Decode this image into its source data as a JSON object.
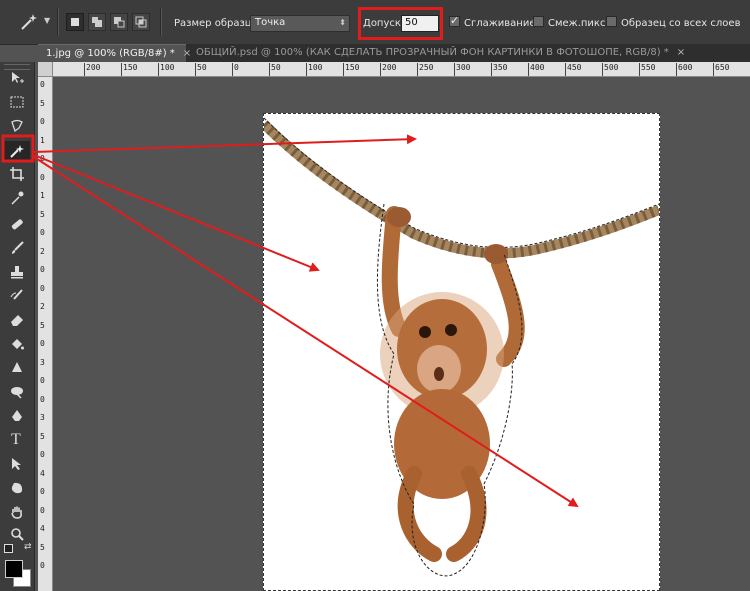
{
  "options_bar": {
    "sample_size_label": "Размер образца:",
    "sample_size_value": "Точка",
    "tolerance_label": "Допуск:",
    "tolerance_value": "50",
    "antialias_label": "Сглаживание",
    "antialias_checked": true,
    "contiguous_label": "Смеж.пикс",
    "contiguous_checked": false,
    "all_layers_label": "Образец со всех слоев",
    "all_layers_checked": false,
    "highlight_color": "#e01c1c"
  },
  "tabs": [
    {
      "label": "1.jpg @ 100% (RGB/8#) *",
      "close": "×",
      "active": true
    },
    {
      "label": "ОБЩИЙ.psd @ 100% (КАК СДЕЛАТЬ ПРОЗРАЧНЫЙ ФОН КАРТИНКИ В ФОТОШОПЕ, RGB/8) *",
      "close": "×",
      "active": false
    }
  ],
  "ruler_top": [
    "200",
    "150",
    "100",
    "50",
    "0",
    "50",
    "100",
    "150",
    "200",
    "250",
    "300",
    "350",
    "400",
    "450",
    "500",
    "550",
    "600",
    "650"
  ],
  "ruler_left": [
    "0",
    "5",
    "0",
    "1",
    "0",
    "0",
    "1",
    "5",
    "0",
    "2",
    "0",
    "0",
    "2",
    "5",
    "0",
    "3",
    "0",
    "0",
    "3",
    "5",
    "0",
    "4",
    "0",
    "0",
    "4",
    "5",
    "0"
  ],
  "tools": [
    "move-icon",
    "marquee-icon",
    "lasso-icon",
    "magic-wand-icon",
    "crop-icon",
    "eyedropper-icon",
    "healing-brush-icon",
    "brush-icon",
    "clone-stamp-icon",
    "history-brush-icon",
    "eraser-icon",
    "paint-bucket-icon",
    "blur-icon",
    "dodge-icon",
    "pen-icon",
    "type-icon",
    "path-selection-icon",
    "shape-icon",
    "hand-icon",
    "zoom-icon"
  ],
  "type_tool_glyph": "T",
  "colors": {
    "ui_dark": "#3c3c3c",
    "workspace": "#535353",
    "annotation": "#e01c1c"
  }
}
